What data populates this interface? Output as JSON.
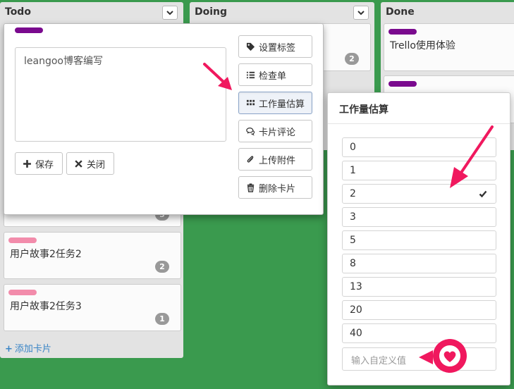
{
  "columns": {
    "todo": {
      "title": "Todo"
    },
    "doing": {
      "title": "Doing",
      "card_badge": "2"
    },
    "done": {
      "title": "Done",
      "cards": [
        {
          "title": "Trello使用体验"
        }
      ]
    }
  },
  "todo_cards": [
    {
      "badge": "5"
    },
    {
      "title": "用户故事2任务2",
      "badge": "2"
    },
    {
      "title": "用户故事2任务3",
      "badge": "1"
    }
  ],
  "add_card": "添加卡片",
  "card_popup": {
    "description": "leangoo博客编写",
    "save": "保存",
    "close": "关闭",
    "actions": {
      "set_label": "设置标签",
      "checklist": "检查单",
      "estimate": "工作量估算",
      "comment": "卡片评论",
      "attach": "上传附件",
      "delete": "删除卡片"
    }
  },
  "estimate_popup": {
    "title": "工作量估算",
    "options": [
      "0",
      "1",
      "2",
      "3",
      "5",
      "8",
      "13",
      "20",
      "40"
    ],
    "selected": "2",
    "custom_placeholder": "输入自定义值"
  },
  "colors": {
    "board_bg": "#3a9a4e",
    "label_purple": "#7a0a8e",
    "label_pink": "#f28cab",
    "annotation": "#f0185e"
  },
  "icons": [
    "chevron-down-icon",
    "tag-icon",
    "list-icon",
    "grid-icon",
    "comments-icon",
    "paperclip-icon",
    "trash-icon",
    "plus-icon",
    "times-icon",
    "check-icon",
    "heart-icon"
  ]
}
